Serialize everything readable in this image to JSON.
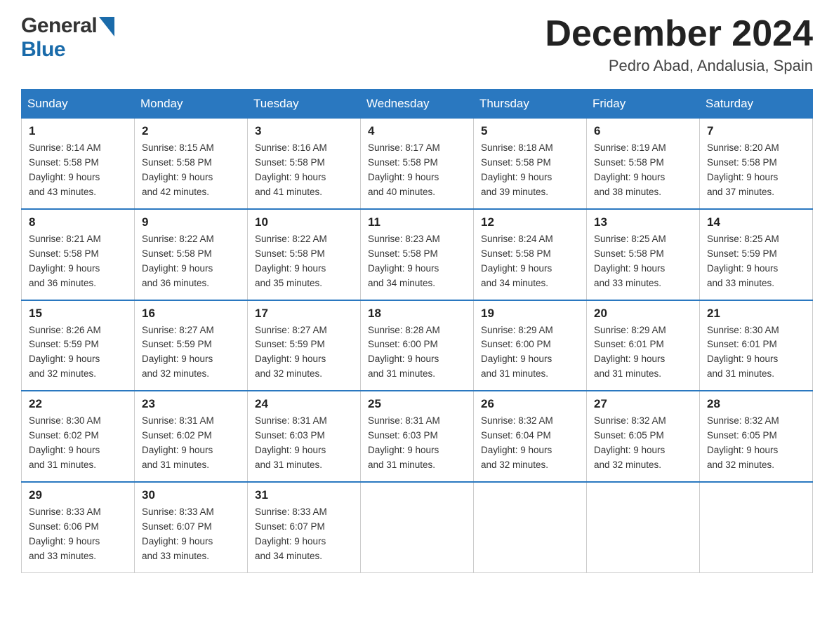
{
  "header": {
    "logo_general": "General",
    "logo_blue": "Blue",
    "month_title": "December 2024",
    "location": "Pedro Abad, Andalusia, Spain"
  },
  "weekdays": [
    "Sunday",
    "Monday",
    "Tuesday",
    "Wednesday",
    "Thursday",
    "Friday",
    "Saturday"
  ],
  "weeks": [
    [
      {
        "day": "1",
        "sunrise": "8:14 AM",
        "sunset": "5:58 PM",
        "daylight": "9 hours and 43 minutes."
      },
      {
        "day": "2",
        "sunrise": "8:15 AM",
        "sunset": "5:58 PM",
        "daylight": "9 hours and 42 minutes."
      },
      {
        "day": "3",
        "sunrise": "8:16 AM",
        "sunset": "5:58 PM",
        "daylight": "9 hours and 41 minutes."
      },
      {
        "day": "4",
        "sunrise": "8:17 AM",
        "sunset": "5:58 PM",
        "daylight": "9 hours and 40 minutes."
      },
      {
        "day": "5",
        "sunrise": "8:18 AM",
        "sunset": "5:58 PM",
        "daylight": "9 hours and 39 minutes."
      },
      {
        "day": "6",
        "sunrise": "8:19 AM",
        "sunset": "5:58 PM",
        "daylight": "9 hours and 38 minutes."
      },
      {
        "day": "7",
        "sunrise": "8:20 AM",
        "sunset": "5:58 PM",
        "daylight": "9 hours and 37 minutes."
      }
    ],
    [
      {
        "day": "8",
        "sunrise": "8:21 AM",
        "sunset": "5:58 PM",
        "daylight": "9 hours and 36 minutes."
      },
      {
        "day": "9",
        "sunrise": "8:22 AM",
        "sunset": "5:58 PM",
        "daylight": "9 hours and 36 minutes."
      },
      {
        "day": "10",
        "sunrise": "8:22 AM",
        "sunset": "5:58 PM",
        "daylight": "9 hours and 35 minutes."
      },
      {
        "day": "11",
        "sunrise": "8:23 AM",
        "sunset": "5:58 PM",
        "daylight": "9 hours and 34 minutes."
      },
      {
        "day": "12",
        "sunrise": "8:24 AM",
        "sunset": "5:58 PM",
        "daylight": "9 hours and 34 minutes."
      },
      {
        "day": "13",
        "sunrise": "8:25 AM",
        "sunset": "5:58 PM",
        "daylight": "9 hours and 33 minutes."
      },
      {
        "day": "14",
        "sunrise": "8:25 AM",
        "sunset": "5:59 PM",
        "daylight": "9 hours and 33 minutes."
      }
    ],
    [
      {
        "day": "15",
        "sunrise": "8:26 AM",
        "sunset": "5:59 PM",
        "daylight": "9 hours and 32 minutes."
      },
      {
        "day": "16",
        "sunrise": "8:27 AM",
        "sunset": "5:59 PM",
        "daylight": "9 hours and 32 minutes."
      },
      {
        "day": "17",
        "sunrise": "8:27 AM",
        "sunset": "5:59 PM",
        "daylight": "9 hours and 32 minutes."
      },
      {
        "day": "18",
        "sunrise": "8:28 AM",
        "sunset": "6:00 PM",
        "daylight": "9 hours and 31 minutes."
      },
      {
        "day": "19",
        "sunrise": "8:29 AM",
        "sunset": "6:00 PM",
        "daylight": "9 hours and 31 minutes."
      },
      {
        "day": "20",
        "sunrise": "8:29 AM",
        "sunset": "6:01 PM",
        "daylight": "9 hours and 31 minutes."
      },
      {
        "day": "21",
        "sunrise": "8:30 AM",
        "sunset": "6:01 PM",
        "daylight": "9 hours and 31 minutes."
      }
    ],
    [
      {
        "day": "22",
        "sunrise": "8:30 AM",
        "sunset": "6:02 PM",
        "daylight": "9 hours and 31 minutes."
      },
      {
        "day": "23",
        "sunrise": "8:31 AM",
        "sunset": "6:02 PM",
        "daylight": "9 hours and 31 minutes."
      },
      {
        "day": "24",
        "sunrise": "8:31 AM",
        "sunset": "6:03 PM",
        "daylight": "9 hours and 31 minutes."
      },
      {
        "day": "25",
        "sunrise": "8:31 AM",
        "sunset": "6:03 PM",
        "daylight": "9 hours and 31 minutes."
      },
      {
        "day": "26",
        "sunrise": "8:32 AM",
        "sunset": "6:04 PM",
        "daylight": "9 hours and 32 minutes."
      },
      {
        "day": "27",
        "sunrise": "8:32 AM",
        "sunset": "6:05 PM",
        "daylight": "9 hours and 32 minutes."
      },
      {
        "day": "28",
        "sunrise": "8:32 AM",
        "sunset": "6:05 PM",
        "daylight": "9 hours and 32 minutes."
      }
    ],
    [
      {
        "day": "29",
        "sunrise": "8:33 AM",
        "sunset": "6:06 PM",
        "daylight": "9 hours and 33 minutes."
      },
      {
        "day": "30",
        "sunrise": "8:33 AM",
        "sunset": "6:07 PM",
        "daylight": "9 hours and 33 minutes."
      },
      {
        "day": "31",
        "sunrise": "8:33 AM",
        "sunset": "6:07 PM",
        "daylight": "9 hours and 34 minutes."
      },
      null,
      null,
      null,
      null
    ]
  ],
  "labels": {
    "sunrise": "Sunrise:",
    "sunset": "Sunset:",
    "daylight": "Daylight:"
  }
}
